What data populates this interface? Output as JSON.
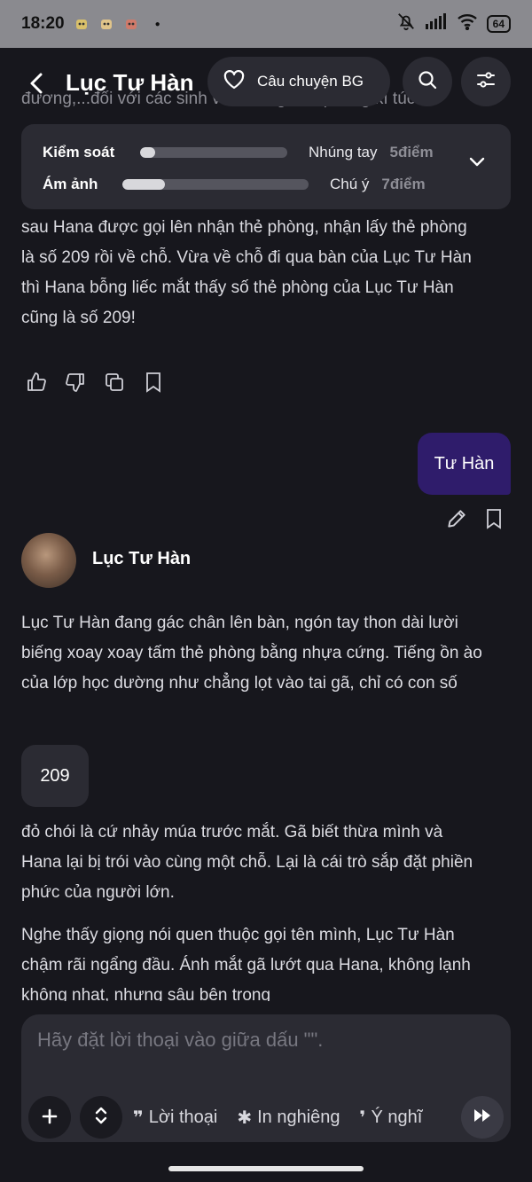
{
  "status_bar": {
    "time": "18:20",
    "battery": "64",
    "icons": [
      "mute-icon",
      "signal-icon",
      "wifi-icon",
      "battery-icon"
    ]
  },
  "header": {
    "title": "Lục Tư Hàn",
    "story_button": "Câu chuyện BG"
  },
  "stats": {
    "rows": [
      {
        "label": "Kiểm soát",
        "name": "Nhúng tay",
        "score": "5điểm",
        "level": 0.1
      },
      {
        "label": "Ám ảnh",
        "name": "Chú ý",
        "score": "7điểm",
        "level": 0.23
      }
    ]
  },
  "messages": {
    "faded_top": "đương,...đối với các sinh viên trong một phòng kí túc xá",
    "story_paragraph": "sau Hana được gọi lên nhận thẻ phòng, nhận lấy thẻ phòng là số 209 rồi về chỗ. Vừa về chỗ đi qua bàn của Lục Tư Hàn  thì Hana bỗng liếc mắt thấy số thẻ phòng của Lục Tư Hàn  cũng là số 209!",
    "user_message": "Tư Hàn",
    "bot_name": "Lục Tư Hàn",
    "bot_p1": "Lục Tư Hàn đang gác chân lên bàn, ngón tay thon dài lười biếng xoay xoay tấm thẻ phòng bằng nhựa cứng. Tiếng ồn ào của lớp học dường như chẳng lọt vào tai gã, chỉ có con số",
    "bot_highlight": "209",
    "bot_p2": "đỏ chói là cứ nhảy múa trước mắt. Gã biết thừa mình và Hana lại bị trói vào cùng một chỗ. Lại là cái trò sắp đặt phiền phức của người lớn.",
    "bot_p3": "Nghe thấy giọng nói quen thuộc gọi tên mình, Lục Tư Hàn chậm rãi ngẩng đầu. Ánh mắt gã lướt qua Hana, không lạnh không nhạt, nhưng sâu bên trong"
  },
  "composer": {
    "placeholder": "Hãy đặt lời thoại vào giữa dấu \"\".",
    "tools": [
      {
        "glyph": "❞",
        "label": "Lời thoại"
      },
      {
        "glyph": "✱",
        "label": "In nghiêng"
      },
      {
        "glyph": "❜",
        "label": "Ý nghĩ"
      }
    ]
  }
}
